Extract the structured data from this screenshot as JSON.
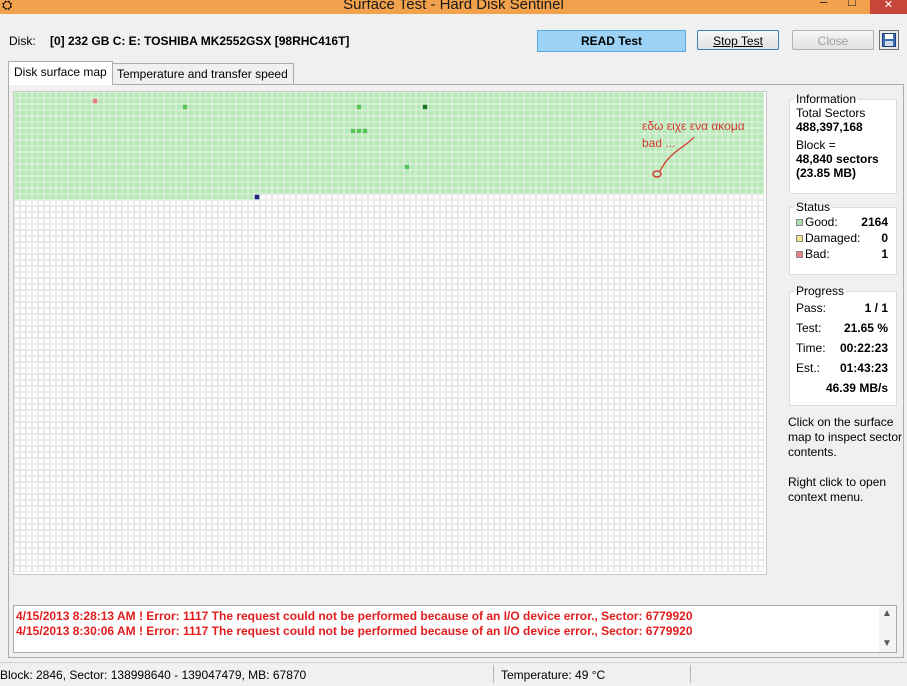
{
  "window": {
    "title": "Surface Test - Hard Disk Sentinel"
  },
  "toolbar": {
    "disk_label": "Disk:",
    "disk_value": "[0] 232 GB C: E: TOSHIBA MK2552GSX [98RHC416T]",
    "test_type": "READ Test",
    "stop_label": "Stop Test",
    "close_label": "Close"
  },
  "tabs": [
    {
      "label": "Disk surface map",
      "active": true
    },
    {
      "label": "Temperature and transfer speed",
      "active": false
    }
  ],
  "annotation": "εδω ειχε ενα ακομα\nbad ...",
  "information": {
    "legend": "Information",
    "total_sectors_label": "Total Sectors",
    "total_sectors_value": "488,397,168",
    "block_label": "Block =",
    "block_sectors": "48,840 sectors",
    "block_size": "(23.85 MB)"
  },
  "status": {
    "legend": "Status",
    "good_label": "Good:",
    "good_value": "2164",
    "good_color": "#a8e0a8",
    "damaged_label": "Damaged:",
    "damaged_value": "0",
    "damaged_color": "#f0e68c",
    "bad_label": "Bad:",
    "bad_value": "1",
    "bad_color": "#e8808a"
  },
  "progress": {
    "legend": "Progress",
    "pass_label": "Pass:",
    "pass_value": "1 / 1",
    "test_label": "Test:",
    "test_value": "21.65 %",
    "time_label": "Time:",
    "time_value": "00:22:23",
    "est_label": "Est.:",
    "est_value": "01:43:23",
    "speed_value": "46.39 MB/s"
  },
  "help": {
    "inspect": "Click on the surface map to inspect sector contents.",
    "context": "Right click to open context menu."
  },
  "log": [
    "4/15/2013  8:28:13 AM ! Error: 1117 The request could not be performed because of an I/O device error., Sector: 6779920",
    "4/15/2013  8:30:06 AM ! Error: 1117 The request could not be performed because of an I/O device error., Sector: 6779920"
  ],
  "statusbar": {
    "block_info": "Block: 2846, Sector: 138998640 - 139047479, MB: 67870",
    "temperature": "Temperature: 49  °C"
  },
  "surface_map": {
    "columns": 125,
    "rows": 80,
    "tested_blocks": 2165,
    "colors": {
      "untested": "#ffffff",
      "good": "#b7eab7",
      "good_fast": "#57c457",
      "good_slow": "#1f7a1f",
      "bad": "#e57c86",
      "current": "#1b2a80",
      "grid": "#d4d4d4"
    }
  }
}
